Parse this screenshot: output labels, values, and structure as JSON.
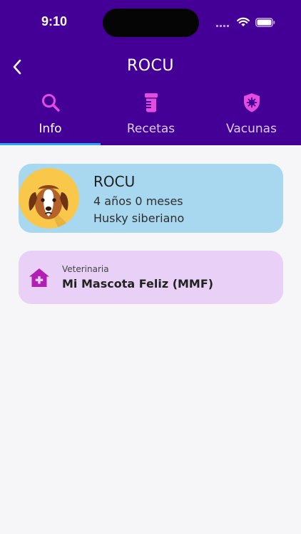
{
  "status": {
    "time": "9:10"
  },
  "header": {
    "title": "ROCU",
    "back_icon": "chevron-left-icon"
  },
  "tabs": [
    {
      "label": "Info",
      "icon": "search-icon",
      "active": true
    },
    {
      "label": "Recetas",
      "icon": "pill-bottle-icon",
      "active": false
    },
    {
      "label": "Vacunas",
      "icon": "shield-virus-icon",
      "active": false
    }
  ],
  "pet": {
    "name": "ROCU",
    "age": "4 años 0 meses",
    "breed": "Husky siberiano",
    "avatar": "dog-avatar-icon"
  },
  "vet": {
    "label": "Veterinaria",
    "name": "Mi Mascota Feliz (MMF)",
    "icon": "house-medical-icon"
  },
  "colors": {
    "header": "#440096",
    "tab_icon": "#e44ce0",
    "tab_indicator": "#2aa6f0",
    "pet_card": "#a8d8ef",
    "vet_card": "#e8d0f6",
    "vet_icon": "#b21fb4"
  }
}
